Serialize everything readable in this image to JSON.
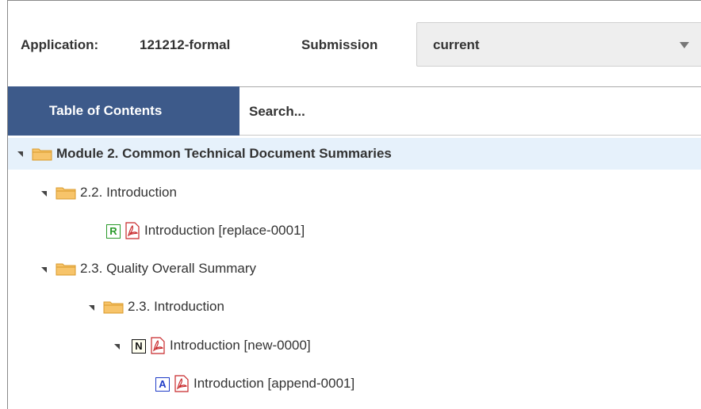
{
  "header": {
    "application_label": "Application:",
    "application_value": "121212-formal",
    "submission_label": "Submission",
    "submission_select_value": "current"
  },
  "toolbar": {
    "toc_tab_label": "Table of Contents",
    "search_placeholder": "Search..."
  },
  "tree": {
    "nodes": [
      {
        "label": "Module 2. Common Technical Document Summaries",
        "type": "folder",
        "selected": true
      },
      {
        "label": "2.2. Introduction",
        "type": "folder"
      },
      {
        "label": "Introduction [replace-0001]",
        "type": "document",
        "badge": "R"
      },
      {
        "label": "2.3. Quality Overall Summary",
        "type": "folder"
      },
      {
        "label": "2.3. Introduction",
        "type": "folder"
      },
      {
        "label": "Introduction [new-0000]",
        "type": "document",
        "badge": "N"
      },
      {
        "label": "Introduction [append-0001]",
        "type": "document",
        "badge": "A"
      }
    ]
  },
  "colors": {
    "toc_tab_bg": "#3d5a8a",
    "selected_row_bg": "#e6f1fb",
    "badge_replace": "#2a9a2a",
    "badge_append": "#1f3cc7"
  }
}
